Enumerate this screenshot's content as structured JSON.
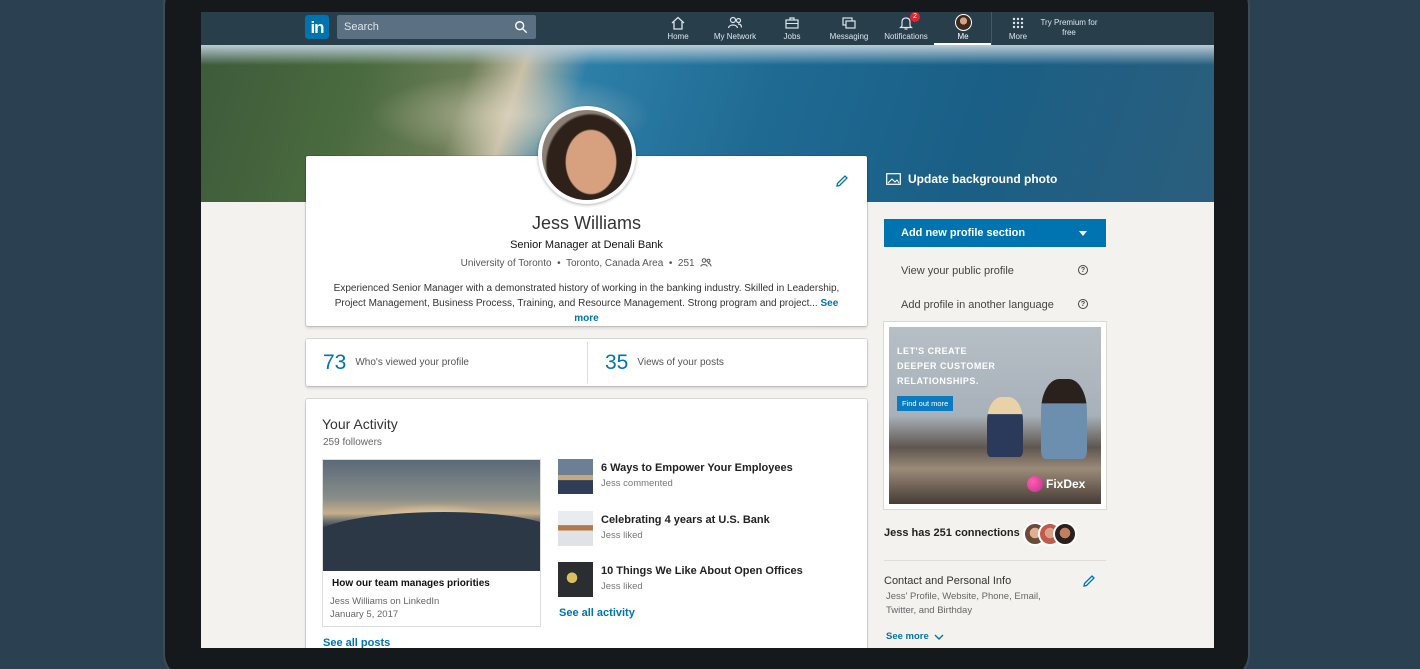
{
  "nav": {
    "search_placeholder": "Search",
    "items": [
      {
        "label": "Home",
        "icon": "home-icon"
      },
      {
        "label": "My Network",
        "icon": "network-icon"
      },
      {
        "label": "Jobs",
        "icon": "briefcase-icon"
      },
      {
        "label": "Messaging",
        "icon": "messaging-icon"
      },
      {
        "label": "Notifications",
        "icon": "bell-icon",
        "badge": "2"
      },
      {
        "label": "Me",
        "icon": "avatar"
      },
      {
        "label": "More",
        "icon": "grid-icon"
      }
    ],
    "premium": "Try Premium for free"
  },
  "hero": {
    "update_bg": "Update background photo"
  },
  "profile": {
    "name": "Jess Williams",
    "title": "Senior Manager at Denali Bank",
    "school": "University of Toronto",
    "location": "Toronto, Canada Area",
    "connections": "251",
    "about": "Experienced Senior Manager with a demonstrated history of working in the banking industry. Skilled in Leadership, Project Management, Business Process, Training, and Resource Management. Strong program and project...",
    "see_more": "See more"
  },
  "stats": [
    {
      "num": "73",
      "label": "Who's viewed your profile"
    },
    {
      "num": "35",
      "label": "Views of your posts"
    }
  ],
  "activity": {
    "title": "Your Activity",
    "followers": "259 followers",
    "post": {
      "title": "How our team manages priorities",
      "author": "Jess Williams on LinkedIn",
      "date": "January 5, 2017"
    },
    "see_posts": "See all posts",
    "items": [
      {
        "title": "6 Ways to Empower Your Employees",
        "who": "Jess commented"
      },
      {
        "title": "Celebrating 4 years at U.S. Bank",
        "who": "Jess liked"
      },
      {
        "title": "10 Things We Like About Open Offices",
        "who": "Jess liked"
      }
    ],
    "see_activity": "See all activity"
  },
  "rail": {
    "add_section": "Add new profile section",
    "public_profile": "View your public profile",
    "another_language": "Add profile in another language",
    "ad": {
      "text": [
        "LET'S CREATE",
        "DEEPER CUSTOMER",
        "RELATIONSHIPS."
      ],
      "button": "Find out more",
      "brand": "FixDex"
    },
    "connections": "Jess has 251 connections",
    "contact_title": "Contact and Personal Info",
    "contact_sub": "Jess' Profile, Website, Phone, Email, Twitter, and Birthday",
    "see_more": "See more"
  },
  "colors": {
    "accent": "#0073b1",
    "nav_bg": "#283e4a",
    "badge": "#e0262e"
  }
}
